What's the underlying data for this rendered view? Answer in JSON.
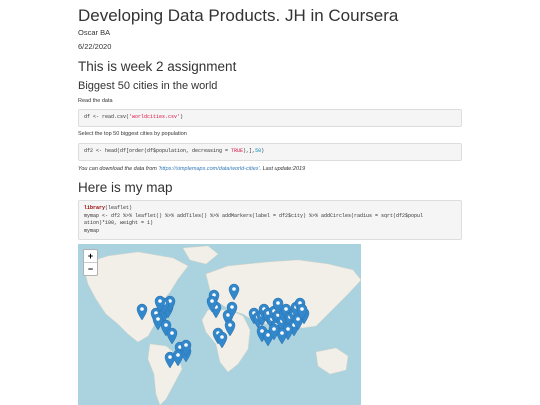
{
  "title": "Developing Data Products. JH in Coursera",
  "author": "Oscar BA",
  "date": "6/22/2020",
  "section1": "This is week 2 assignment",
  "subsection1": "Biggest 50 cities in the world",
  "read_label": "Read the data",
  "code1": {
    "pre": "df <- read.csv(",
    "str": "'worldcities.csv'",
    "post": ")"
  },
  "select_label": "Select the top 50 biggest cities by population",
  "code2": {
    "pre": "df2 <- head(df[order(df$population, decreasing = ",
    "kw": "TRUE",
    "mid": "),],",
    "num": "50",
    "post": ")"
  },
  "download": {
    "pre": "You can download the data from ",
    "link": "'https://simplemaps.com/data/world-cities'",
    "post": ". Last update:2019"
  },
  "section2": "Here is my map",
  "code3": {
    "lib_kw": "library",
    "lib_rest": "(leaflet)",
    "line2": "mymap <- df2 %>% leaflet() %>% addTiles() %>% addMarkers(label = df2$city) %>% addCircles(radius = sqrt(df2$popul",
    "line3": "ation)*100, weight = 1)",
    "line4": "mymap"
  },
  "map": {
    "zoom_in": "+",
    "zoom_out": "−",
    "water_color": "#aad3df",
    "land_color": "#f2efe9",
    "marker_color": "#3388cc"
  }
}
